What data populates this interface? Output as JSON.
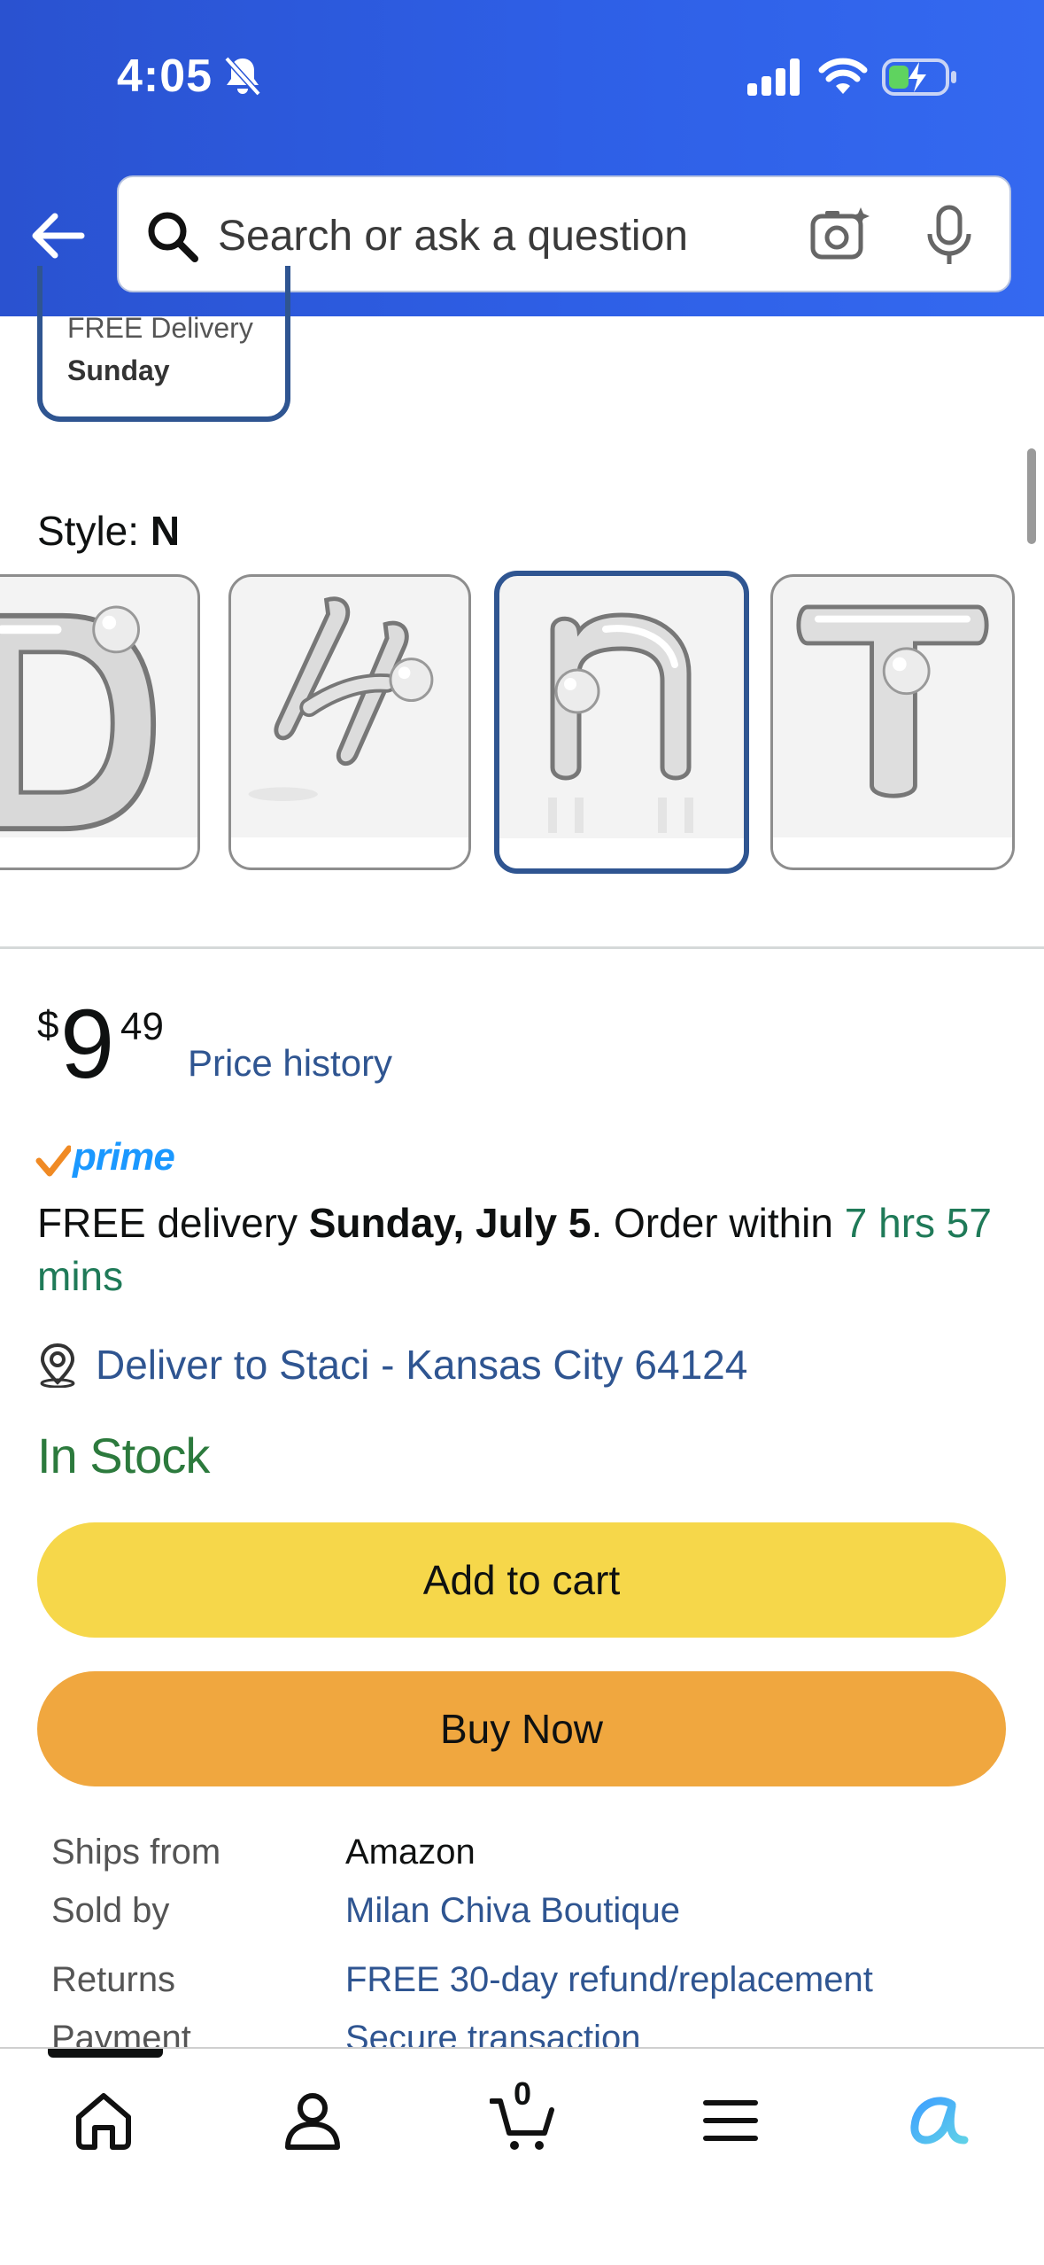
{
  "status_bar": {
    "time": "4:05",
    "icons": [
      "bell-slash-icon",
      "signal-icon",
      "wifi-icon",
      "battery-charging-icon"
    ]
  },
  "header": {
    "search_placeholder": "Search or ask a question",
    "icons": [
      "back-arrow-icon",
      "search-icon",
      "camera-icon",
      "microphone-icon"
    ],
    "background": "#2e5fe6"
  },
  "delivery_option": {
    "line1": "FREE Delivery",
    "line2": "Sunday"
  },
  "style": {
    "label": "Style: ",
    "selected": "N",
    "swatches": [
      "D",
      "H",
      "N",
      "T"
    ],
    "selected_index": 2
  },
  "price": {
    "symbol": "$",
    "whole": "9",
    "fraction": "49",
    "history_link": "Price history"
  },
  "prime": {
    "badge": "prime"
  },
  "delivery": {
    "prefix": "FREE delivery ",
    "date": "Sunday, July 5",
    "middle": ". Order within ",
    "countdown": "7 hrs 57 mins"
  },
  "deliver_to": {
    "text": "Deliver to Staci - Kansas City 64124"
  },
  "stock": {
    "status": "In Stock"
  },
  "buttons": {
    "add_to_cart": "Add to cart",
    "buy_now": "Buy Now"
  },
  "seller_info": {
    "rows": [
      {
        "label": "Ships from",
        "value": "Amazon"
      },
      {
        "label": "Sold by",
        "value": "Milan Chiva Boutique"
      },
      {
        "label": "Returns",
        "value": "FREE 30-day refund/replacement"
      },
      {
        "label": "Payment",
        "value": "Secure transaction"
      }
    ]
  },
  "tabbar": {
    "cart_count": "0",
    "tabs": [
      "home-icon",
      "account-icon",
      "cart-icon",
      "menu-icon",
      "rufus-icon"
    ]
  },
  "colors": {
    "accent_link": "#2f5591",
    "in_stock": "#2c7a3d",
    "add_to_cart": "#f6d74a",
    "buy_now": "#f0a73f",
    "prime": "#1a98ff"
  }
}
